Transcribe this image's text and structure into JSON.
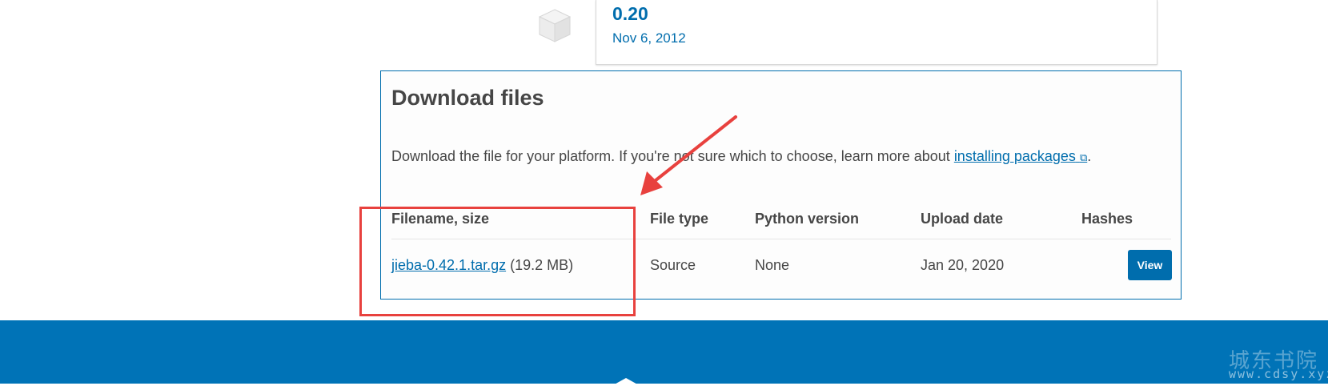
{
  "release": {
    "version": "0.20",
    "date": "Nov 6, 2012",
    "icon": "package-box-icon"
  },
  "download": {
    "title": "Download files",
    "description_prefix": "Download the file for your platform. If you're not sure which to choose, learn more about ",
    "link_text": "installing packages",
    "external_glyph": "⧉",
    "description_suffix": ".",
    "columns": [
      "Filename, size",
      "File type",
      "Python version",
      "Upload date",
      "Hashes"
    ],
    "rows": [
      {
        "filename": "jieba-0.42.1.tar.gz",
        "size": "(19.2 MB)",
        "file_type": "Source",
        "python_version": "None",
        "upload_date": "Jan 20, 2020",
        "hashes_button": "View"
      }
    ]
  },
  "watermark": {
    "cn": "城东书院",
    "url": "www.cdsy.xyz"
  },
  "colors": {
    "accent": "#006dad",
    "footer": "#0073b7",
    "annotation": "#e8413e",
    "text": "#464646"
  }
}
